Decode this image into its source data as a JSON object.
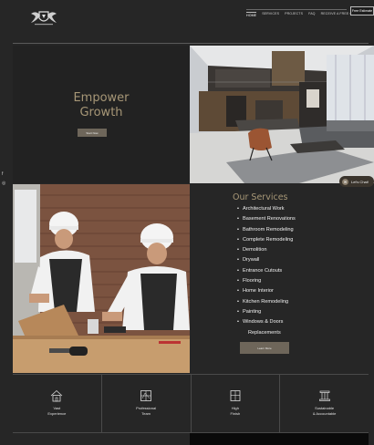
{
  "nav": {
    "items": [
      "HOME",
      "SERVICES",
      "PROJECTS",
      "FAQ",
      "RECEIVE A FREE QUOTE"
    ],
    "cta": "Free Estimate"
  },
  "hero": {
    "title_line1": "Empower",
    "title_line2": "Growth",
    "button": "Start Now"
  },
  "social": {
    "facebook": "f",
    "instagram": "◎"
  },
  "services": {
    "title": "Our Services",
    "items": [
      "Architectural Work",
      "Basement Renovations",
      "Bathroom Remodeling",
      "Complete Remodeling",
      "Demolition",
      "Drywall",
      "Entrance Cutouts",
      "Flooring",
      "Home Interior",
      "Kitchen Remodeling",
      "Painting",
      "Windows & Doors"
    ],
    "items_continuation": "Replacements",
    "button": "Learn More"
  },
  "chat": {
    "label": "Let's Chat!"
  },
  "features": [
    {
      "label": "Vast\nExperience",
      "icon": "house-icon"
    },
    {
      "label": "Professional\nTeam",
      "icon": "blueprint-icon"
    },
    {
      "label": "High\nFinish",
      "icon": "window-icon"
    },
    {
      "label": "Sustainable\n& Accountable",
      "icon": "pillar-icon"
    }
  ],
  "colors": {
    "background": "#262626",
    "accent": "#a79777",
    "button": "#6e665a"
  }
}
